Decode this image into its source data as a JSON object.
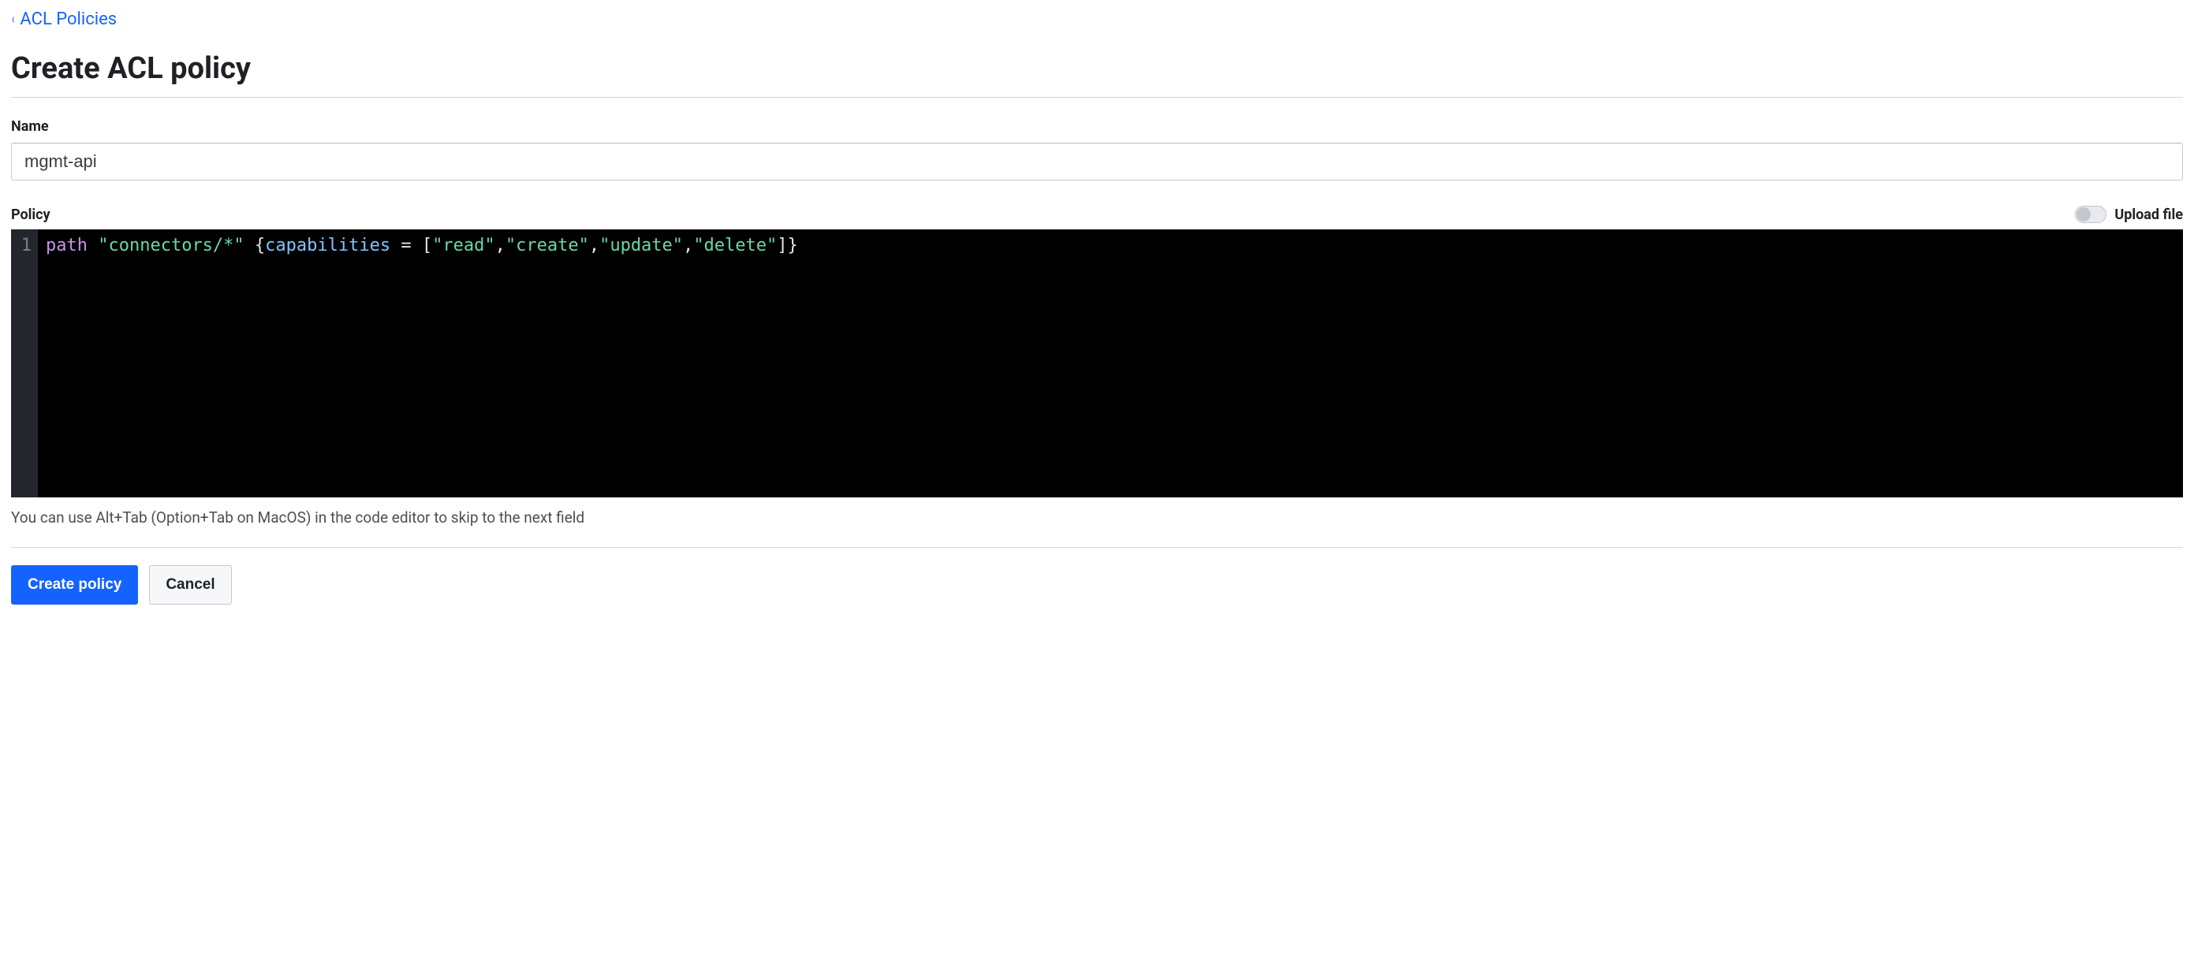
{
  "breadcrumb": {
    "parent_label": "ACL Policies"
  },
  "page": {
    "title": "Create ACL policy"
  },
  "name_field": {
    "label": "Name",
    "value": "mgmt-api"
  },
  "policy_field": {
    "label": "Policy",
    "upload_label": "Upload file",
    "upload_enabled": false,
    "hint": "You can use Alt+Tab (Option+Tab on MacOS) in the code editor to skip to the next field",
    "code": {
      "line_number": "1",
      "tokens": {
        "kw_path": "path",
        "sp1": " ",
        "str_path": "\"connectors/*\"",
        "sp2": " ",
        "brace_open": "{",
        "attr_caps": "capabilities",
        "sp3": " ",
        "eq": "=",
        "sp4": " ",
        "bracket_open": "[",
        "str_read": "\"read\"",
        "comma1": ",",
        "str_create": "\"create\"",
        "comma2": ",",
        "str_update": "\"update\"",
        "comma3": ",",
        "str_delete": "\"delete\"",
        "bracket_close": "]",
        "brace_close": "}"
      },
      "raw": "path \"connectors/*\" {capabilities = [\"read\",\"create\",\"update\",\"delete\"]}"
    }
  },
  "actions": {
    "primary_label": "Create policy",
    "secondary_label": "Cancel"
  }
}
